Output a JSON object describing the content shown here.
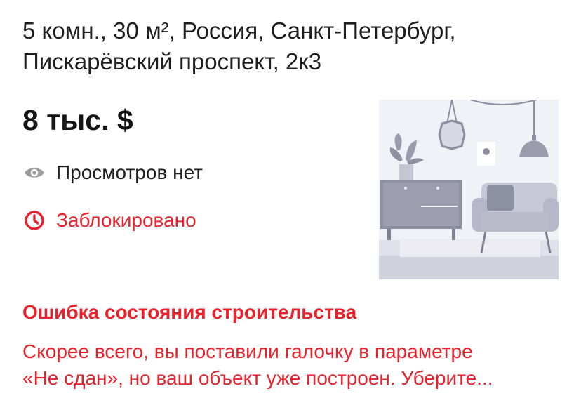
{
  "listing": {
    "title": "5 комн., 30 м², Россия, Санкт-Петербург, Пискарёвский проспект, 2к3",
    "price": "8 тыс. $",
    "views_text": "Просмотров нет",
    "status_text": "Заблокировано",
    "thumbnail_icon": "room-interior-placeholder-icon"
  },
  "error": {
    "title": "Ошибка состояния строительства",
    "text": "Скорее всего, вы поставили галочку в параметре\n«Не сдан», но ваш объект уже построен. Уберите..."
  },
  "colors": {
    "error_red": "#e8212b",
    "icon_gray": "#9e9e9e",
    "illustration_bg": "#f1f2f7",
    "illustration_dark": "#8d8fa3"
  }
}
